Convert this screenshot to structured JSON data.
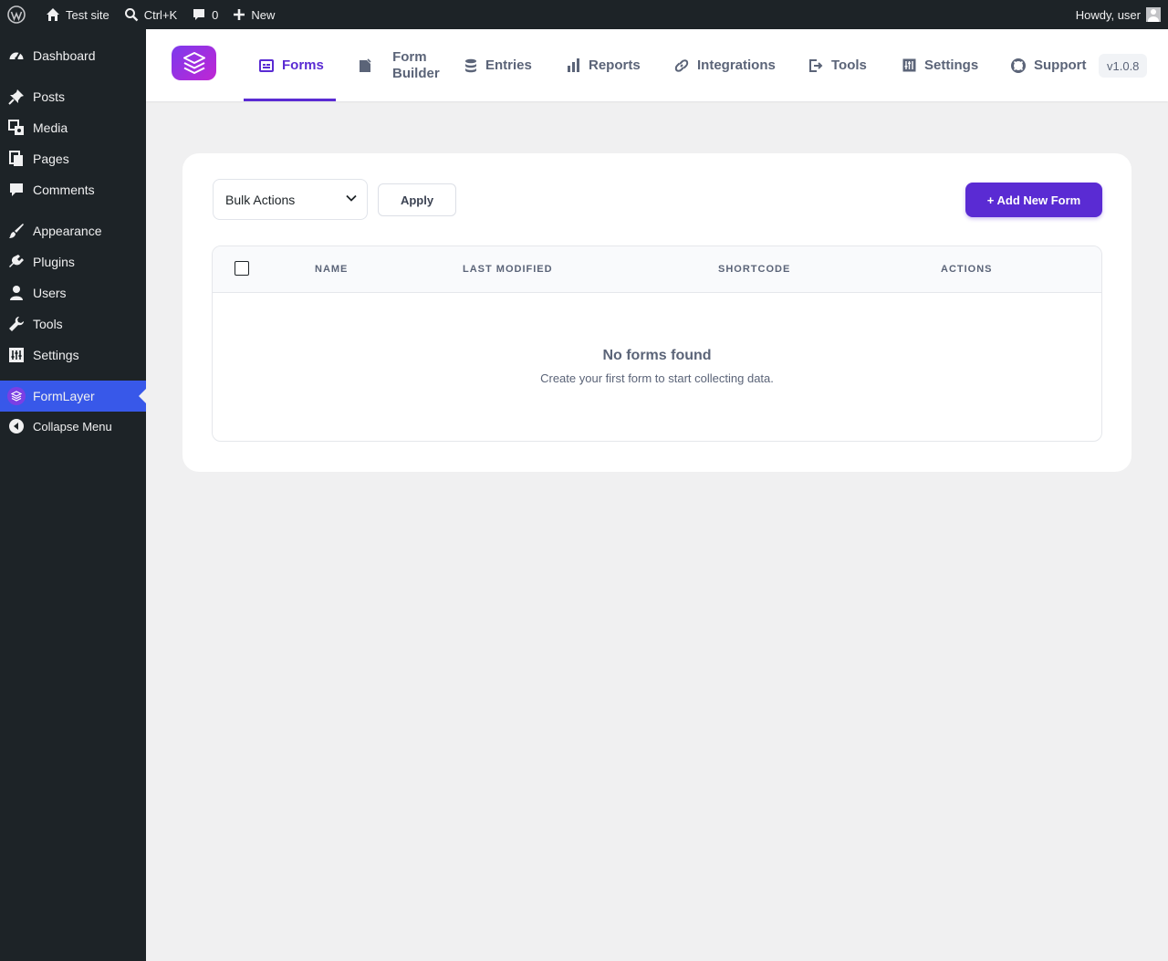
{
  "adminbar": {
    "site_name": "Test site",
    "search_shortcut": "Ctrl+K",
    "comments_count": "0",
    "new_label": "New",
    "greeting": "Howdy, user"
  },
  "sidebar": {
    "items": [
      {
        "label": "Dashboard",
        "icon": "dashboard-icon"
      },
      {
        "label": "Posts",
        "icon": "pin-icon"
      },
      {
        "label": "Media",
        "icon": "media-icon"
      },
      {
        "label": "Pages",
        "icon": "pages-icon"
      },
      {
        "label": "Comments",
        "icon": "comment-icon"
      },
      {
        "label": "Appearance",
        "icon": "brush-icon"
      },
      {
        "label": "Plugins",
        "icon": "plugin-icon"
      },
      {
        "label": "Users",
        "icon": "user-icon"
      },
      {
        "label": "Tools",
        "icon": "wrench-icon"
      },
      {
        "label": "Settings",
        "icon": "sliders-icon"
      },
      {
        "label": "FormLayer",
        "icon": "layers-icon",
        "active": true
      }
    ],
    "collapse_label": "Collapse Menu"
  },
  "plugin_nav": {
    "tabs": [
      {
        "label": "Forms",
        "icon": "forms-icon",
        "active": true
      },
      {
        "label_line1": "Form",
        "label_line2": "Builder",
        "icon": "form-builder-icon"
      },
      {
        "label": "Entries",
        "icon": "database-icon"
      },
      {
        "label": "Reports",
        "icon": "bar-chart-icon"
      },
      {
        "label": "Integrations",
        "icon": "link-icon"
      },
      {
        "label": "Tools",
        "icon": "export-icon"
      },
      {
        "label": "Settings",
        "icon": "settings-icon"
      },
      {
        "label": "Support",
        "icon": "lifebuoy-icon"
      }
    ],
    "version": "v1.0.8"
  },
  "toolbar": {
    "bulk_actions_value": "Bulk Actions",
    "apply_label": "Apply",
    "add_new_label": "+ Add New Form"
  },
  "table": {
    "columns": [
      "NAME",
      "LAST MODIFIED",
      "SHORTCODE",
      "ACTIONS"
    ],
    "empty_title": "No forms found",
    "empty_subtitle": "Create your first form to start collecting data."
  },
  "colors": {
    "accent": "#5a2bd3",
    "admin_dark": "#1d2327",
    "active_menu": "#3858e9"
  }
}
